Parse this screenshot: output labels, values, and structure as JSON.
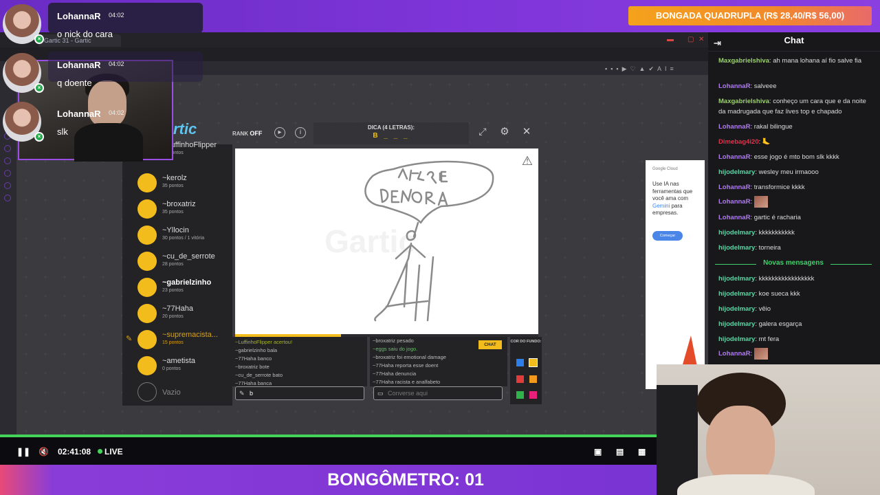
{
  "promo": {
    "text": "BONGADA QUADRUPLA (R$ 28,40/R$ 56,00)",
    "color": "#f4a21c"
  },
  "overlay_messages": [
    {
      "user": "LohannaR",
      "time": "04:02",
      "message": "o nick do cara"
    },
    {
      "user": "LohannaR",
      "time": "04:02",
      "message": "q doente"
    },
    {
      "user": "LohannaR",
      "time": "04:02",
      "message": "slk"
    }
  ],
  "browser": {
    "tab_title": "Gartic 31 - Gartic"
  },
  "game": {
    "logo": "rtic",
    "rank_label": "RANK",
    "rank_value": "OFF",
    "hint_label": "DICA (4 LETRAS):",
    "hint_value": "B _ _ _",
    "watermark": "Gartic",
    "players": [
      {
        "name": "~LuffinhoFlipper",
        "points": "36 pontos"
      },
      {
        "name": "~kerolz",
        "points": "35 pontos"
      },
      {
        "name": "~broxatriz",
        "points": "35 pontos"
      },
      {
        "name": "~Yllocin",
        "points": "30 pontos / 1 vitória"
      },
      {
        "name": "~cu_de_serrote",
        "points": "28 pontos"
      },
      {
        "name": "~gabrielzinho",
        "points": "23 pontos"
      },
      {
        "name": "~77Haha",
        "points": "20 pontos"
      },
      {
        "name": "~supremacista...",
        "points": "15 pontos"
      },
      {
        "name": "~ametista",
        "points": "0 pontos"
      }
    ],
    "empty_slot": "Vazio",
    "progress": 0.35,
    "answers": [
      "~LuffinhoFlipper acertou!",
      "~gabrielzinho bala",
      "~77Haha banco",
      "~broxatriz bote",
      "~cu_de_serrote bato",
      "~77Haha banca"
    ],
    "chatlog": [
      "~broxatriz pesado",
      "~eggs saiu do jogo.",
      "~broxatriz foi emotional damage",
      "~77Haha reporta esse doent",
      "~77Haha denuncia",
      "~77Haha racista e analfabeto"
    ],
    "chat_tag": "CHAT",
    "answer_input": "b",
    "chat_placeholder": "Converse aqui",
    "bg_color_label": "COR DO FUNDO:",
    "swatches": [
      "#2d7ee8",
      "#f2bd1c",
      "#e03c3c",
      "#f29a1c",
      "#2fb34a",
      "#e8207a"
    ]
  },
  "ad": {
    "brand": "Google Cloud",
    "text": "Use IA nas ferramentas que você ama com",
    "highlight": "Gemini",
    "text2": "para empresas.",
    "button": "Começar"
  },
  "chat": {
    "title": "Chat",
    "messages": [
      {
        "user": "Maxgabrielshiva",
        "color": "#9ad36a",
        "text": "ah mana lohana aí fio salve fia"
      },
      {
        "user": "LohannaR",
        "color": "#b07cf0",
        "text": "salveee"
      },
      {
        "user": "Maxgabrielshiva",
        "color": "#9ad36a",
        "text": "conheço um cara que e da noite da madrugada que faz lives top e chapado"
      },
      {
        "user": "LohannaR",
        "color": "#b07cf0",
        "text": "rakal bilingue"
      },
      {
        "user": "Dimebag4i20",
        "color": "#e0334c",
        "text": "🦶"
      },
      {
        "user": "LohannaR",
        "color": "#b07cf0",
        "text": "esse jogo é mto bom slk kkkk"
      },
      {
        "user": "hijodelmary",
        "color": "#5fd4a6",
        "text": "wesley meu irmaooo"
      },
      {
        "user": "LohannaR",
        "color": "#b07cf0",
        "text": "transformice kkkk"
      },
      {
        "user": "LohannaR",
        "color": "#b07cf0",
        "text": ""
      },
      {
        "user": "LohannaR",
        "color": "#b07cf0",
        "text": "gartic é racharia"
      },
      {
        "user": "hijodelmary",
        "color": "#5fd4a6",
        "text": "kkkkkkkkkkk"
      },
      {
        "user": "hijodelmary",
        "color": "#5fd4a6",
        "text": "torneira"
      }
    ],
    "new_messages_label": "Novas mensagens",
    "new_messages": [
      {
        "user": "hijodelmary",
        "color": "#5fd4a6",
        "text": "kkkkkkkkkkkkkkkkk"
      },
      {
        "user": "hijodelmary",
        "color": "#5fd4a6",
        "text": "koe sueca kkk"
      },
      {
        "user": "hijodelmary",
        "color": "#5fd4a6",
        "text": "vêio"
      },
      {
        "user": "hijodelmary",
        "color": "#5fd4a6",
        "text": "galera esgarça"
      },
      {
        "user": "hijodelmary",
        "color": "#5fd4a6",
        "text": "mt fera"
      },
      {
        "user": "LohannaR",
        "color": "#b07cf0",
        "text": ""
      }
    ]
  },
  "player": {
    "time": "02:41:08",
    "live": "LIVE"
  },
  "bottom_text": "BONGÔMETRO: 01"
}
